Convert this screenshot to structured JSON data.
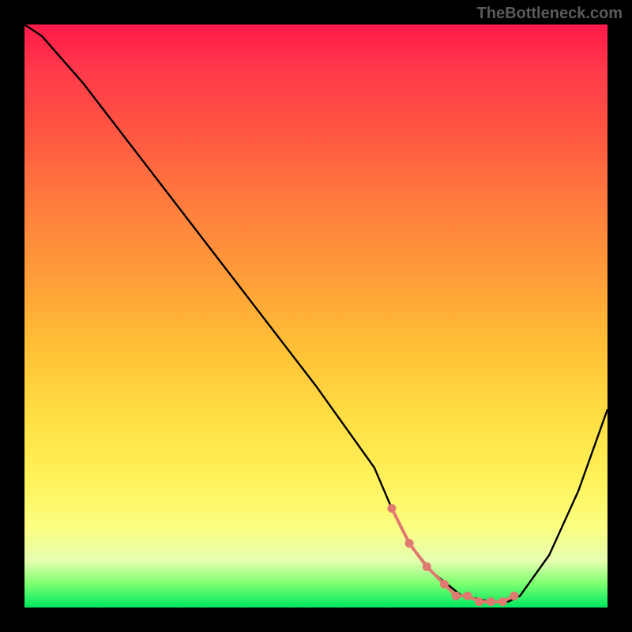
{
  "watermark": "TheBottleneck.com",
  "chart_data": {
    "type": "line",
    "title": "",
    "xlabel": "",
    "ylabel": "",
    "xlim": [
      0,
      100
    ],
    "ylim": [
      0,
      100
    ],
    "grid": false,
    "series": [
      {
        "name": "curve",
        "color": "#000000",
        "x": [
          0,
          3,
          10,
          20,
          30,
          40,
          50,
          60,
          63,
          66,
          70,
          75,
          80,
          83,
          85,
          90,
          95,
          100
        ],
        "values": [
          100,
          98,
          90,
          77,
          64,
          51,
          38,
          24,
          17,
          11,
          6,
          2,
          1,
          1,
          2,
          9,
          20,
          34
        ]
      }
    ],
    "markers": {
      "name": "highlight-dots",
      "color": "#e07a70",
      "x": [
        63,
        66,
        69,
        72,
        74,
        76,
        78,
        80,
        82,
        84
      ],
      "values": [
        17,
        11,
        7,
        4,
        2,
        2,
        1,
        1,
        1,
        2
      ]
    },
    "background_gradient_meaning": "red=high bottleneck, green=low bottleneck"
  }
}
